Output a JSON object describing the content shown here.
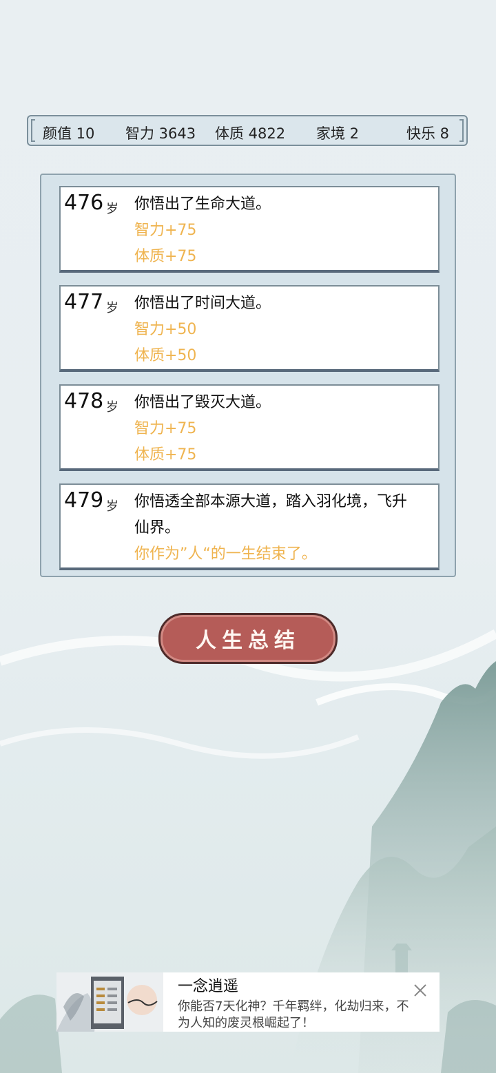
{
  "stats": [
    {
      "label": "颜值 10"
    },
    {
      "label": "智力 3643"
    },
    {
      "label": "体质 4822"
    },
    {
      "label": "家境 2"
    },
    {
      "label": "快乐 8"
    }
  ],
  "events": [
    {
      "age": "476",
      "unit": "岁",
      "lines": [
        "你悟出了生命大道。"
      ],
      "effects": [
        "智力+75",
        "体质+75"
      ]
    },
    {
      "age": "477",
      "unit": "岁",
      "lines": [
        "你悟出了时间大道。"
      ],
      "effects": [
        "智力+50",
        "体质+50"
      ]
    },
    {
      "age": "478",
      "unit": "岁",
      "lines": [
        "你悟出了毁灭大道。"
      ],
      "effects": [
        "智力+75",
        "体质+75"
      ]
    },
    {
      "age": "479",
      "unit": "岁",
      "lines": [
        "你悟透全部本源大道，踏入羽化境，飞升",
        "仙界。"
      ],
      "effects": [
        "你作为”人“的一生结束了。"
      ]
    }
  ],
  "summary_button": {
    "label": "人生总结"
  },
  "ad": {
    "title": "一念逍遥",
    "description": "你能否7天化神？千年羁绊，化劫归来，不为人知的废灵根崛起了！",
    "icons": {
      "close": "close-icon",
      "thumbnail": "game-thumbnail"
    }
  },
  "colors": {
    "effect": "#efb450",
    "button": "#b55c58",
    "panel": "#d6e3ea",
    "border": "#7c8d97"
  }
}
